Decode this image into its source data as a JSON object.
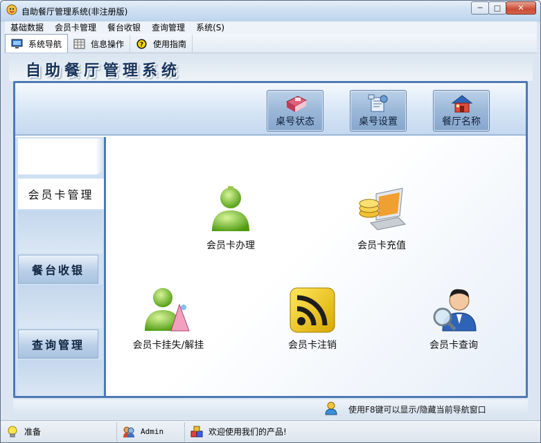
{
  "window": {
    "title": "自助餐厅管理系统(非注册版)"
  },
  "menubar": {
    "items": [
      "基础数据",
      "会员卡管理",
      "餐台收银",
      "查询管理",
      "系统(S)"
    ]
  },
  "toolbar": {
    "tabs": [
      "系统导航",
      "信息操作",
      "使用指南"
    ]
  },
  "banner": {
    "title": "自助餐厅管理系统"
  },
  "top_buttons": [
    {
      "label": "桌号状态",
      "icon": "table-status-icon"
    },
    {
      "label": "桌号设置",
      "icon": "table-settings-icon"
    },
    {
      "label": "餐厅名称",
      "icon": "restaurant-name-icon"
    }
  ],
  "leftnav": {
    "items": [
      "会员卡管理",
      "餐台收银",
      "查询管理"
    ],
    "active": "会员卡管理"
  },
  "functions": [
    {
      "label": "会员卡办理",
      "icon": "green-user-icon"
    },
    {
      "label": "会员卡充值",
      "icon": "coins-laptop-icon"
    },
    {
      "label": "会员卡挂失/解挂",
      "icon": "user-cone-icon"
    },
    {
      "label": "会员卡注销",
      "icon": "rss-icon"
    },
    {
      "label": "会员卡查询",
      "icon": "user-search-icon"
    }
  ],
  "hint": {
    "text": "使用F8键可以显示/隐藏当前导航窗口"
  },
  "status": {
    "ready": "准备",
    "user": "Admin",
    "welcome": "欢迎使用我们的产品!"
  },
  "colors": {
    "frame": "#4d79b3",
    "title_text": "#17345b",
    "accent_green": "#7cc130"
  }
}
